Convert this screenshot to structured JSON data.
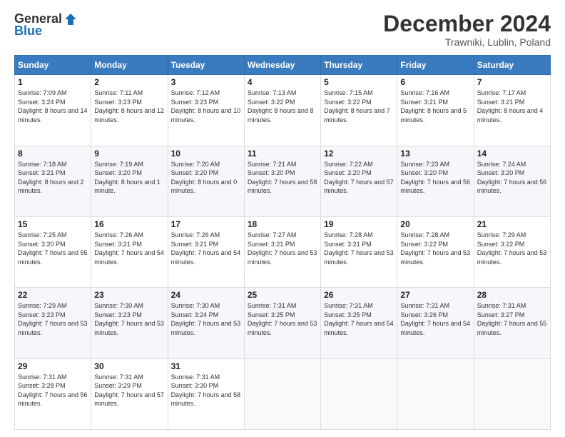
{
  "header": {
    "logo_general": "General",
    "logo_blue": "Blue",
    "month_title": "December 2024",
    "location": "Trawniki, Lublin, Poland"
  },
  "calendar": {
    "days": [
      "Sunday",
      "Monday",
      "Tuesday",
      "Wednesday",
      "Thursday",
      "Friday",
      "Saturday"
    ],
    "weeks": [
      [
        {
          "day": "1",
          "sunrise": "Sunrise: 7:09 AM",
          "sunset": "Sunset: 3:24 PM",
          "daylight": "Daylight: 8 hours and 14 minutes."
        },
        {
          "day": "2",
          "sunrise": "Sunrise: 7:11 AM",
          "sunset": "Sunset: 3:23 PM",
          "daylight": "Daylight: 8 hours and 12 minutes."
        },
        {
          "day": "3",
          "sunrise": "Sunrise: 7:12 AM",
          "sunset": "Sunset: 3:23 PM",
          "daylight": "Daylight: 8 hours and 10 minutes."
        },
        {
          "day": "4",
          "sunrise": "Sunrise: 7:13 AM",
          "sunset": "Sunset: 3:22 PM",
          "daylight": "Daylight: 8 hours and 8 minutes."
        },
        {
          "day": "5",
          "sunrise": "Sunrise: 7:15 AM",
          "sunset": "Sunset: 3:22 PM",
          "daylight": "Daylight: 8 hours and 7 minutes."
        },
        {
          "day": "6",
          "sunrise": "Sunrise: 7:16 AM",
          "sunset": "Sunset: 3:21 PM",
          "daylight": "Daylight: 8 hours and 5 minutes."
        },
        {
          "day": "7",
          "sunrise": "Sunrise: 7:17 AM",
          "sunset": "Sunset: 3:21 PM",
          "daylight": "Daylight: 8 hours and 4 minutes."
        }
      ],
      [
        {
          "day": "8",
          "sunrise": "Sunrise: 7:18 AM",
          "sunset": "Sunset: 3:21 PM",
          "daylight": "Daylight: 8 hours and 2 minutes."
        },
        {
          "day": "9",
          "sunrise": "Sunrise: 7:19 AM",
          "sunset": "Sunset: 3:20 PM",
          "daylight": "Daylight: 8 hours and 1 minute."
        },
        {
          "day": "10",
          "sunrise": "Sunrise: 7:20 AM",
          "sunset": "Sunset: 3:20 PM",
          "daylight": "Daylight: 8 hours and 0 minutes."
        },
        {
          "day": "11",
          "sunrise": "Sunrise: 7:21 AM",
          "sunset": "Sunset: 3:20 PM",
          "daylight": "Daylight: 7 hours and 58 minutes."
        },
        {
          "day": "12",
          "sunrise": "Sunrise: 7:22 AM",
          "sunset": "Sunset: 3:20 PM",
          "daylight": "Daylight: 7 hours and 57 minutes."
        },
        {
          "day": "13",
          "sunrise": "Sunrise: 7:23 AM",
          "sunset": "Sunset: 3:20 PM",
          "daylight": "Daylight: 7 hours and 56 minutes."
        },
        {
          "day": "14",
          "sunrise": "Sunrise: 7:24 AM",
          "sunset": "Sunset: 3:20 PM",
          "daylight": "Daylight: 7 hours and 56 minutes."
        }
      ],
      [
        {
          "day": "15",
          "sunrise": "Sunrise: 7:25 AM",
          "sunset": "Sunset: 3:20 PM",
          "daylight": "Daylight: 7 hours and 55 minutes."
        },
        {
          "day": "16",
          "sunrise": "Sunrise: 7:26 AM",
          "sunset": "Sunset: 3:21 PM",
          "daylight": "Daylight: 7 hours and 54 minutes."
        },
        {
          "day": "17",
          "sunrise": "Sunrise: 7:26 AM",
          "sunset": "Sunset: 3:21 PM",
          "daylight": "Daylight: 7 hours and 54 minutes."
        },
        {
          "day": "18",
          "sunrise": "Sunrise: 7:27 AM",
          "sunset": "Sunset: 3:21 PM",
          "daylight": "Daylight: 7 hours and 53 minutes."
        },
        {
          "day": "19",
          "sunrise": "Sunrise: 7:28 AM",
          "sunset": "Sunset: 3:21 PM",
          "daylight": "Daylight: 7 hours and 53 minutes."
        },
        {
          "day": "20",
          "sunrise": "Sunrise: 7:28 AM",
          "sunset": "Sunset: 3:22 PM",
          "daylight": "Daylight: 7 hours and 53 minutes."
        },
        {
          "day": "21",
          "sunrise": "Sunrise: 7:29 AM",
          "sunset": "Sunset: 3:22 PM",
          "daylight": "Daylight: 7 hours and 53 minutes."
        }
      ],
      [
        {
          "day": "22",
          "sunrise": "Sunrise: 7:29 AM",
          "sunset": "Sunset: 3:23 PM",
          "daylight": "Daylight: 7 hours and 53 minutes."
        },
        {
          "day": "23",
          "sunrise": "Sunrise: 7:30 AM",
          "sunset": "Sunset: 3:23 PM",
          "daylight": "Daylight: 7 hours and 53 minutes."
        },
        {
          "day": "24",
          "sunrise": "Sunrise: 7:30 AM",
          "sunset": "Sunset: 3:24 PM",
          "daylight": "Daylight: 7 hours and 53 minutes."
        },
        {
          "day": "25",
          "sunrise": "Sunrise: 7:31 AM",
          "sunset": "Sunset: 3:25 PM",
          "daylight": "Daylight: 7 hours and 53 minutes."
        },
        {
          "day": "26",
          "sunrise": "Sunrise: 7:31 AM",
          "sunset": "Sunset: 3:25 PM",
          "daylight": "Daylight: 7 hours and 54 minutes."
        },
        {
          "day": "27",
          "sunrise": "Sunrise: 7:31 AM",
          "sunset": "Sunset: 3:26 PM",
          "daylight": "Daylight: 7 hours and 54 minutes."
        },
        {
          "day": "28",
          "sunrise": "Sunrise: 7:31 AM",
          "sunset": "Sunset: 3:27 PM",
          "daylight": "Daylight: 7 hours and 55 minutes."
        }
      ],
      [
        {
          "day": "29",
          "sunrise": "Sunrise: 7:31 AM",
          "sunset": "Sunset: 3:28 PM",
          "daylight": "Daylight: 7 hours and 56 minutes."
        },
        {
          "day": "30",
          "sunrise": "Sunrise: 7:31 AM",
          "sunset": "Sunset: 3:29 PM",
          "daylight": "Daylight: 7 hours and 57 minutes."
        },
        {
          "day": "31",
          "sunrise": "Sunrise: 7:31 AM",
          "sunset": "Sunset: 3:30 PM",
          "daylight": "Daylight: 7 hours and 58 minutes."
        },
        null,
        null,
        null,
        null
      ]
    ]
  }
}
